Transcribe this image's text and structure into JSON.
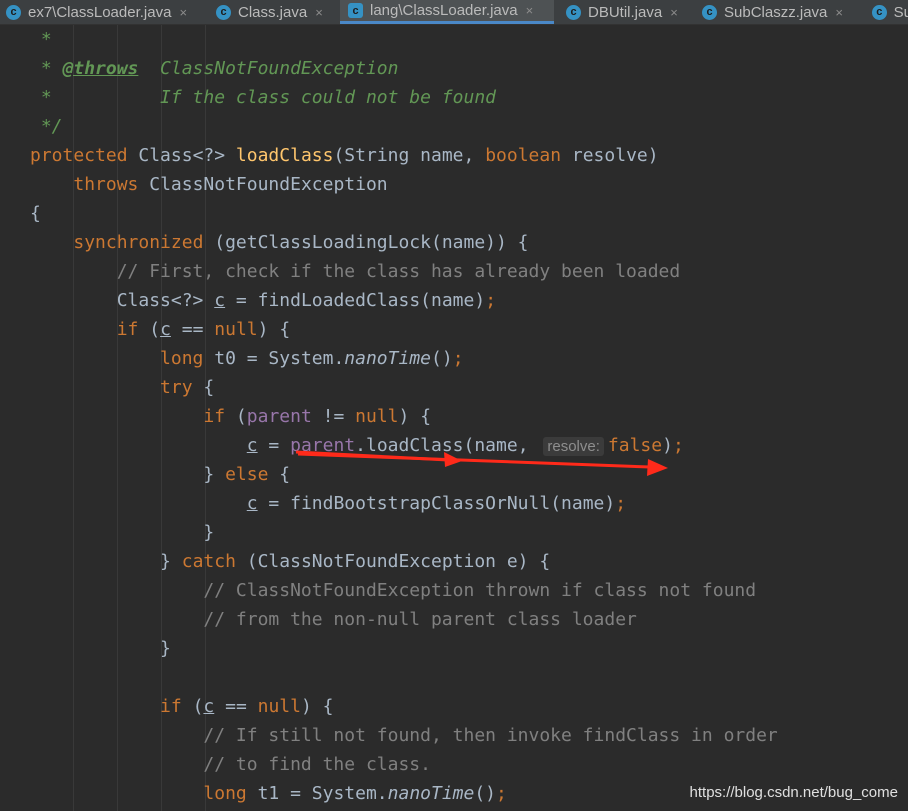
{
  "tabs": [
    {
      "label": "ex7\\ClassLoader.java",
      "close": "×",
      "active": false
    },
    {
      "label": "Class.java",
      "close": "×",
      "active": false
    },
    {
      "label": "lang\\ClassLoader.java",
      "close": "×",
      "active": true
    },
    {
      "label": "DBUtil.java",
      "close": "×",
      "active": false
    },
    {
      "label": "SubClaszz.java",
      "close": "×",
      "active": false
    },
    {
      "label": "Su",
      "close": "",
      "active": false
    }
  ],
  "code": {
    "l1": {
      "a": " *"
    },
    "l2": {
      "a": " * ",
      "tag": "@throws",
      "b": "  ClassNotFoundException"
    },
    "l3": {
      "a": " *          If the class could not be found"
    },
    "l4": {
      "a": " */"
    },
    "l5": {
      "k1": "protected",
      "t1": " Class<?> ",
      "fn": "loadClass",
      "t2": "(String name, ",
      "k2": "boolean",
      "t3": " resolve)"
    },
    "l6": {
      "ind": "    ",
      "k1": "throws",
      "t1": " ClassNotFoundException"
    },
    "l7": {
      "t1": "{"
    },
    "l8": {
      "ind": "    ",
      "k1": "synchronized",
      "t1": " (getClassLoadingLock(name)) {"
    },
    "l9": {
      "ind": "        ",
      "c": "// First, check if the class has already been loaded"
    },
    "l10": {
      "ind": "        ",
      "t1": "Class<?> ",
      "v": "c",
      "t2": " = findLoadedClass(name)",
      "k1": ";"
    },
    "l11": {
      "ind": "        ",
      "k1": "if",
      "t1": " (",
      "v": "c",
      "t2": " == ",
      "k2": "null",
      "t3": ") {"
    },
    "l12": {
      "ind": "            ",
      "k1": "long",
      "t1": " t0 = System.",
      "st": "nanoTime",
      "t2": "()",
      "k2": ";"
    },
    "l13": {
      "ind": "            ",
      "k1": "try",
      "t1": " {"
    },
    "l14": {
      "ind": "                ",
      "k1": "if",
      "t1": " (",
      "f": "parent",
      "t2": " != ",
      "k2": "null",
      "t3": ") {"
    },
    "l15": {
      "ind": "                    ",
      "v": "c",
      "t1": " = ",
      "f": "parent",
      "t2": ".loadClass(name, ",
      "hint": "resolve:",
      "k1": "false",
      "t3": ")",
      "k2": ";"
    },
    "l16": {
      "ind": "                ",
      "t1": "} ",
      "k1": "else",
      "t2": " {"
    },
    "l17": {
      "ind": "                    ",
      "v": "c",
      "t1": " = findBootstrapClassOrNull(name)",
      "k1": ";"
    },
    "l18": {
      "ind": "                ",
      "t1": "}"
    },
    "l19": {
      "ind": "            ",
      "t1": "} ",
      "k1": "catch",
      "t2": " (ClassNotFoundException e) {"
    },
    "l20": {
      "ind": "                ",
      "c": "// ClassNotFoundException thrown if class not found"
    },
    "l21": {
      "ind": "                ",
      "c": "// from the non-null parent class loader"
    },
    "l22": {
      "ind": "            ",
      "t1": "}"
    },
    "l23": {
      "ind": "            ",
      "k1": "if",
      "t1": " (",
      "v": "c",
      "t2": " == ",
      "k2": "null",
      "t3": ") {"
    },
    "l24": {
      "ind": "                ",
      "c": "// If still not found, then invoke findClass in order"
    },
    "l25": {
      "ind": "                ",
      "c": "// to find the class."
    },
    "l26": {
      "ind": "                ",
      "k1": "long",
      "t1": " t1 = System.",
      "st": "nanoTime",
      "t2": "()",
      "k2": ";"
    }
  },
  "watermark": "https://blog.csdn.net/bug_come",
  "colors": {
    "keyword": "#cc7832",
    "method": "#ffc66d",
    "doc": "#629755",
    "comment": "#808080",
    "field": "#9876aa",
    "text": "#a9b7c6",
    "background": "#2b2b2b",
    "arrow": "#ff2a1a"
  }
}
